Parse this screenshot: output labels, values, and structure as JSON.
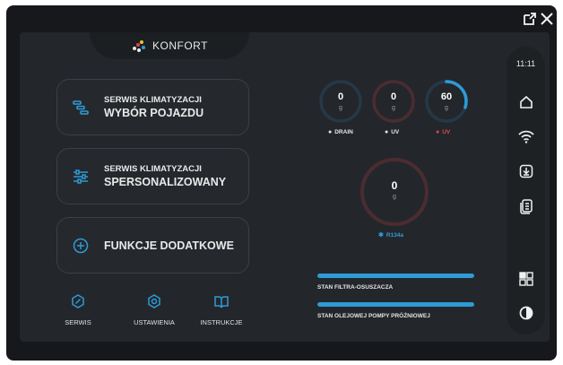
{
  "window": {
    "popout_icon": "external-window-icon",
    "close_icon": "close-icon"
  },
  "brand": {
    "name": "KONFORT",
    "icon": "konfort-logo"
  },
  "menu": [
    {
      "line1": "SERWIS KLIMATYZACJI",
      "line2": "WYBÓR POJAZDU",
      "icon": "vehicle-list-icon"
    },
    {
      "line1": "SERWIS KLIMATYZACJI",
      "line2": "SPERSONALIZOWANY",
      "icon": "sliders-icon"
    },
    {
      "line1": "",
      "line2": "FUNKCJE DODATKOWE",
      "icon": "plus-circle-icon"
    }
  ],
  "bottom_nav": [
    {
      "label": "SERWIS",
      "icon": "wrench-icon"
    },
    {
      "label": "USTAWIENIA",
      "icon": "settings-gear-icon"
    },
    {
      "label": "INSTRUKCJE",
      "icon": "book-icon"
    }
  ],
  "gauges": [
    {
      "value": "0",
      "unit": "g",
      "label": "DRAIN",
      "fraction": 0,
      "label_color": "#e6e6e6"
    },
    {
      "value": "0",
      "unit": "g",
      "label": "UV",
      "fraction": 0,
      "label_color": "#e6e6e6"
    },
    {
      "value": "60",
      "unit": "g",
      "label": "UV",
      "fraction": 0.3,
      "label_color": "#e0454b"
    },
    {
      "value": "0",
      "unit": "g",
      "label": "R134a",
      "fraction": 0,
      "label_color": "#2e9bd6"
    }
  ],
  "status_bars": [
    {
      "label": "STAN FILTRA-OSUSZACZA",
      "fraction": 1.0
    },
    {
      "label": "STAN OLEJOWEJ POMPY PRÓŻNIOWEJ",
      "fraction": 1.0
    }
  ],
  "sidebar": {
    "time": "11:11",
    "icons": [
      "home-icon",
      "wifi-icon",
      "download-icon",
      "documents-icon",
      "layout-grid-icon",
      "contrast-icon"
    ]
  },
  "colors": {
    "accent": "#2e9bd6",
    "warning": "#e0454b",
    "ring_gray": "#3a4048",
    "ring_red": "#4b2c30",
    "ring_blue": "#253848"
  }
}
